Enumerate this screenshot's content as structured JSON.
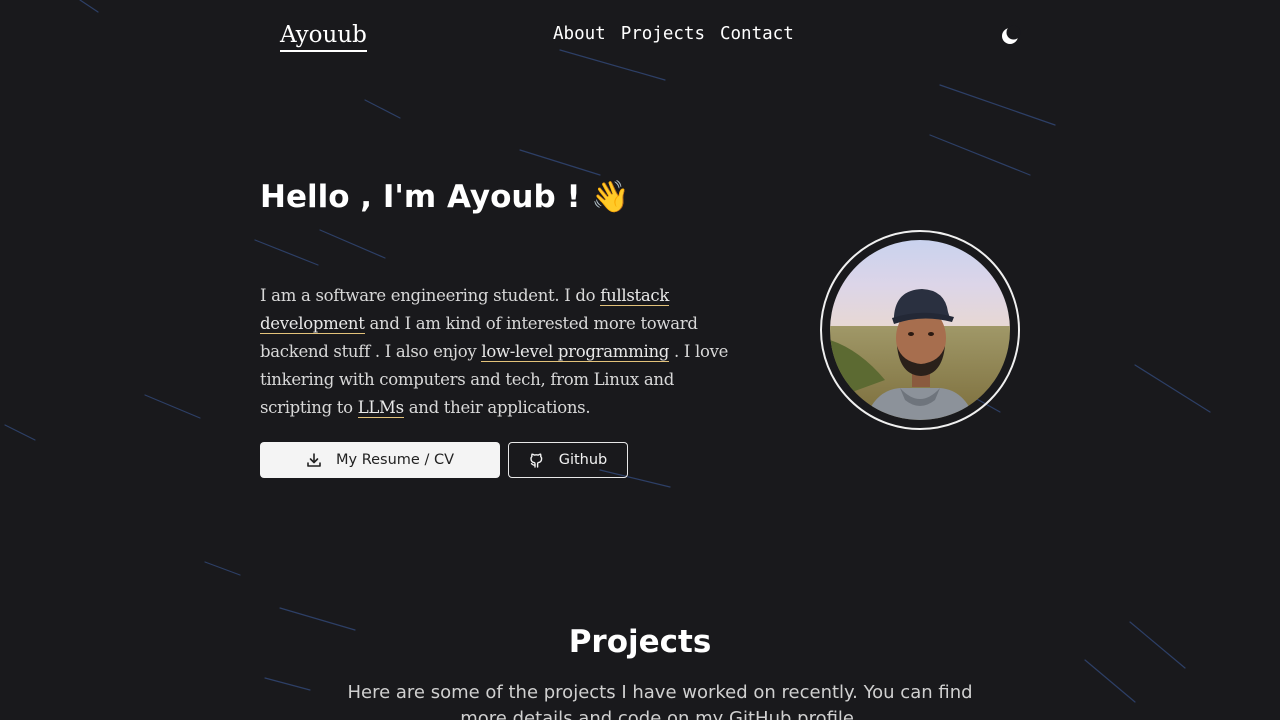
{
  "nav": {
    "logo": "Ayouub",
    "links": [
      "About",
      "Projects",
      "Contact"
    ],
    "theme_icon": "moon-icon"
  },
  "hero": {
    "title": "Hello , I'm Ayoub ! 👋",
    "intro": {
      "t1": "I am a software engineering student. I do ",
      "link1": "fullstack development",
      "t2": " and I am kind of interested more toward backend stuff . I also enjoy ",
      "link2": "low-level programming",
      "t3": " . I love tinkering with computers and tech, from Linux and scripting to ",
      "link3": "LLMs",
      "t4": " and their applications."
    },
    "resume_button": "My Resume / CV",
    "github_button": "Github",
    "resume_icon": "download-icon",
    "github_icon": "github-icon"
  },
  "projects": {
    "title": "Projects",
    "description": "Here are some of the projects I have worked on recently. You can find more details and code on my GitHub profile."
  },
  "colors": {
    "background": "#19191c",
    "link_underline": "#e3c27a",
    "text": "#ffffff"
  }
}
